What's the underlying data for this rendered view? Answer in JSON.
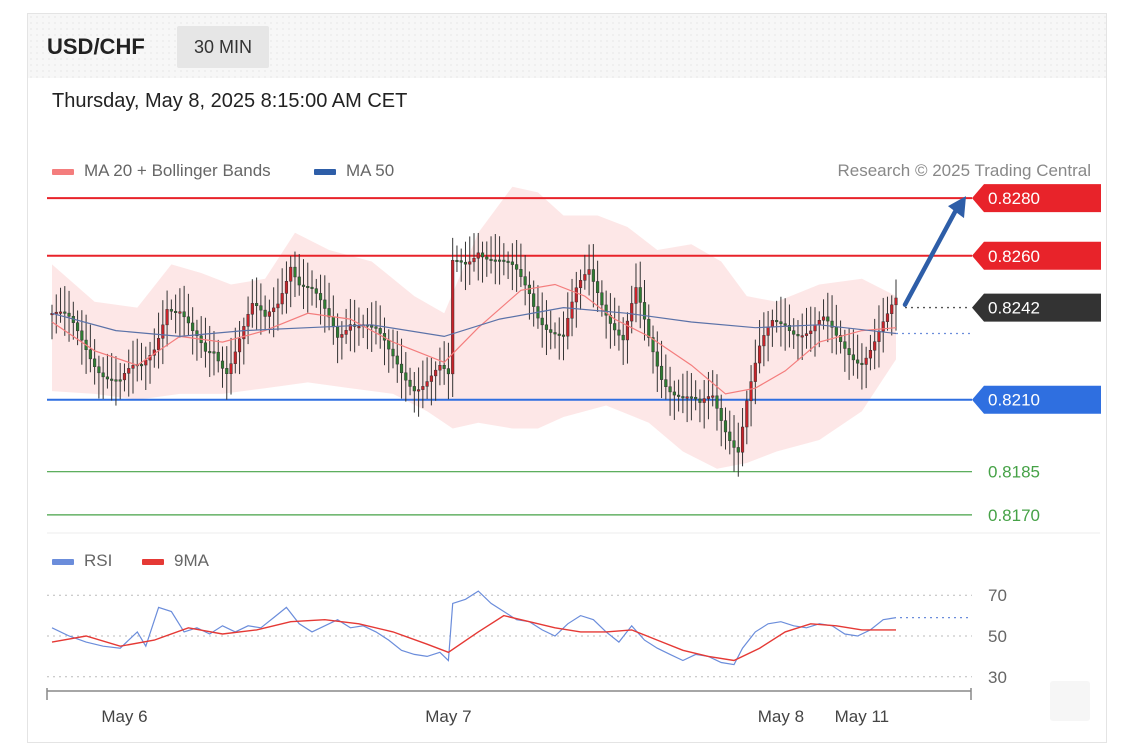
{
  "header": {
    "pair": "USD/CHF",
    "timeframe": "30 MIN",
    "datetime": "Thursday, May 8, 2025 8:15:00 AM CET"
  },
  "legend": {
    "ma20_label": "MA 20 + Bollinger Bands",
    "ma50_label": "MA 50",
    "copyright": "Research © 2025 Trading Central",
    "rsi_label": "RSI",
    "rsi_ma_label": "9MA"
  },
  "colors": {
    "resistance": "#e8232a",
    "support": "#2f6fe0",
    "target": "#46a247",
    "current": "#333333",
    "ma50": "#5b72a8",
    "ma20": "#f47d7d",
    "bollinger": "#fde3e3",
    "arrow": "#2e5ea8",
    "bull": "#c8232a",
    "bear": "#2e7d32",
    "rsi": "#6b8ddb",
    "rsi_ma": "#e53935"
  },
  "chart_data": [
    {
      "type": "candlestick",
      "title": "USD/CHF 30 MIN",
      "x_ticks": [
        "May 6",
        "May 7",
        "May 8",
        "May 11"
      ],
      "ylim": [
        0.8163,
        0.8295
      ],
      "levels": [
        {
          "value": 0.828,
          "label": "0.8280",
          "kind": "resistance"
        },
        {
          "value": 0.826,
          "label": "0.8260",
          "kind": "resistance"
        },
        {
          "value": 0.8242,
          "label": "0.8242",
          "kind": "current"
        },
        {
          "value": 0.821,
          "label": "0.8210",
          "kind": "support"
        },
        {
          "value": 0.8185,
          "label": "0.8185",
          "kind": "target"
        },
        {
          "value": 0.817,
          "label": "0.8170",
          "kind": "target"
        }
      ],
      "close_path": [
        [
          0,
          0.824
        ],
        [
          4,
          0.8235
        ],
        [
          7,
          0.823
        ],
        [
          10,
          0.8225
        ],
        [
          13,
          0.822
        ],
        [
          16,
          0.8215
        ],
        [
          19,
          0.8218
        ],
        [
          21,
          0.822
        ],
        [
          24,
          0.823
        ],
        [
          27,
          0.8245
        ],
        [
          30,
          0.824
        ],
        [
          33,
          0.823
        ],
        [
          36,
          0.8225
        ],
        [
          38,
          0.8228
        ],
        [
          41,
          0.8223
        ],
        [
          44,
          0.8232
        ],
        [
          47,
          0.824
        ],
        [
          50,
          0.8236
        ],
        [
          53,
          0.8245
        ],
        [
          56,
          0.826
        ],
        [
          58,
          0.8252
        ],
        [
          61,
          0.8246
        ],
        [
          64,
          0.8238
        ],
        [
          67,
          0.8232
        ],
        [
          70,
          0.824
        ],
        [
          73,
          0.8238
        ],
        [
          76,
          0.8232
        ],
        [
          79,
          0.8224
        ],
        [
          82,
          0.822
        ],
        [
          85,
          0.8217
        ],
        [
          88,
          0.8218
        ],
        [
          91,
          0.8219
        ],
        [
          93,
          0.8215
        ],
        [
          94,
          0.8255
        ],
        [
          97,
          0.8258
        ],
        [
          100,
          0.8265
        ],
        [
          103,
          0.826
        ],
        [
          106,
          0.8255
        ],
        [
          109,
          0.8252
        ],
        [
          112,
          0.8248
        ],
        [
          114,
          0.8242
        ],
        [
          117,
          0.8236
        ],
        [
          120,
          0.823
        ],
        [
          123,
          0.8245
        ],
        [
          126,
          0.8255
        ],
        [
          128,
          0.825
        ],
        [
          131,
          0.824
        ],
        [
          134,
          0.823
        ],
        [
          137,
          0.8245
        ],
        [
          140,
          0.823
        ],
        [
          143,
          0.822
        ],
        [
          146,
          0.8215
        ],
        [
          149,
          0.821
        ],
        [
          152,
          0.8205
        ],
        [
          155,
          0.821
        ],
        [
          158,
          0.8202
        ],
        [
          161,
          0.8195
        ],
        [
          163,
          0.821
        ],
        [
          166,
          0.8225
        ],
        [
          169,
          0.8235
        ],
        [
          172,
          0.8238
        ],
        [
          175,
          0.8236
        ],
        [
          178,
          0.8234
        ],
        [
          181,
          0.8235
        ],
        [
          184,
          0.823
        ],
        [
          187,
          0.8228
        ],
        [
          190,
          0.8226
        ],
        [
          193,
          0.823
        ],
        [
          196,
          0.8236
        ],
        [
          198,
          0.8242
        ]
      ],
      "ma20": [
        [
          0,
          0.8237
        ],
        [
          10,
          0.8227
        ],
        [
          20,
          0.8222
        ],
        [
          30,
          0.8232
        ],
        [
          40,
          0.823
        ],
        [
          50,
          0.8234
        ],
        [
          60,
          0.824
        ],
        [
          70,
          0.8238
        ],
        [
          80,
          0.823
        ],
        [
          92,
          0.8223
        ],
        [
          100,
          0.8235
        ],
        [
          110,
          0.8248
        ],
        [
          118,
          0.825
        ],
        [
          125,
          0.8246
        ],
        [
          132,
          0.8238
        ],
        [
          140,
          0.8232
        ],
        [
          150,
          0.8222
        ],
        [
          158,
          0.8212
        ],
        [
          165,
          0.8214
        ],
        [
          172,
          0.822
        ],
        [
          180,
          0.823
        ],
        [
          190,
          0.8234
        ],
        [
          198,
          0.8235
        ]
      ],
      "ma50": [
        [
          0,
          0.824
        ],
        [
          15,
          0.8234
        ],
        [
          30,
          0.8232
        ],
        [
          45,
          0.8234
        ],
        [
          60,
          0.8235
        ],
        [
          75,
          0.8236
        ],
        [
          92,
          0.8232
        ],
        [
          105,
          0.8238
        ],
        [
          120,
          0.8242
        ],
        [
          135,
          0.824
        ],
        [
          150,
          0.8237
        ],
        [
          165,
          0.8235
        ],
        [
          180,
          0.8236
        ],
        [
          198,
          0.8233
        ]
      ],
      "bb_upper": [
        [
          0,
          0.8257
        ],
        [
          10,
          0.8244
        ],
        [
          20,
          0.8242
        ],
        [
          28,
          0.8257
        ],
        [
          35,
          0.8254
        ],
        [
          42,
          0.825
        ],
        [
          50,
          0.8252
        ],
        [
          57,
          0.8268
        ],
        [
          65,
          0.8262
        ],
        [
          75,
          0.8258
        ],
        [
          85,
          0.8246
        ],
        [
          92,
          0.824
        ],
        [
          100,
          0.8268
        ],
        [
          108,
          0.8284
        ],
        [
          114,
          0.8282
        ],
        [
          120,
          0.8274
        ],
        [
          128,
          0.8274
        ],
        [
          135,
          0.827
        ],
        [
          142,
          0.8262
        ],
        [
          150,
          0.8264
        ],
        [
          157,
          0.8258
        ],
        [
          163,
          0.8246
        ],
        [
          170,
          0.8244
        ],
        [
          180,
          0.825
        ],
        [
          190,
          0.8252
        ],
        [
          198,
          0.8246
        ]
      ],
      "bb_lower": [
        [
          0,
          0.8213
        ],
        [
          10,
          0.8212
        ],
        [
          20,
          0.821
        ],
        [
          30,
          0.8212
        ],
        [
          40,
          0.8212
        ],
        [
          50,
          0.8214
        ],
        [
          60,
          0.8216
        ],
        [
          70,
          0.8214
        ],
        [
          80,
          0.8212
        ],
        [
          88,
          0.8206
        ],
        [
          94,
          0.82
        ],
        [
          100,
          0.8202
        ],
        [
          108,
          0.82
        ],
        [
          114,
          0.82
        ],
        [
          120,
          0.8204
        ],
        [
          130,
          0.8208
        ],
        [
          140,
          0.8202
        ],
        [
          148,
          0.8192
        ],
        [
          156,
          0.8186
        ],
        [
          163,
          0.8188
        ],
        [
          170,
          0.8192
        ],
        [
          180,
          0.8196
        ],
        [
          190,
          0.8206
        ],
        [
          198,
          0.8224
        ]
      ],
      "forecast_arrow": {
        "from": 0.8243,
        "to": 0.828
      }
    },
    {
      "type": "line",
      "title": "RSI",
      "ylim": [
        25,
        75
      ],
      "y_ticks": [
        70,
        50,
        30
      ],
      "series": [
        {
          "name": "RSI",
          "values": [
            [
              0,
              54
            ],
            [
              4,
              50
            ],
            [
              8,
              47
            ],
            [
              12,
              45
            ],
            [
              16,
              44
            ],
            [
              20,
              52
            ],
            [
              22,
              45
            ],
            [
              25,
              64
            ],
            [
              28,
              62
            ],
            [
              31,
              52
            ],
            [
              34,
              54
            ],
            [
              37,
              51
            ],
            [
              40,
              55
            ],
            [
              43,
              52
            ],
            [
              46,
              55
            ],
            [
              49,
              54
            ],
            [
              52,
              59
            ],
            [
              55,
              64
            ],
            [
              58,
              56
            ],
            [
              61,
              52
            ],
            [
              64,
              55
            ],
            [
              67,
              58
            ],
            [
              70,
              54
            ],
            [
              73,
              55
            ],
            [
              76,
              52
            ],
            [
              79,
              48
            ],
            [
              82,
              43
            ],
            [
              85,
              41
            ],
            [
              88,
              40
            ],
            [
              91,
              42
            ],
            [
              93,
              38
            ],
            [
              94,
              66
            ],
            [
              97,
              68
            ],
            [
              100,
              72
            ],
            [
              103,
              66
            ],
            [
              106,
              62
            ],
            [
              109,
              58
            ],
            [
              112,
              57
            ],
            [
              115,
              53
            ],
            [
              118,
              50
            ],
            [
              121,
              56
            ],
            [
              124,
              60
            ],
            [
              127,
              58
            ],
            [
              130,
              52
            ],
            [
              133,
              47
            ],
            [
              136,
              55
            ],
            [
              139,
              48
            ],
            [
              142,
              44
            ],
            [
              145,
              41
            ],
            [
              148,
              38
            ],
            [
              151,
              41
            ],
            [
              154,
              40
            ],
            [
              157,
              37
            ],
            [
              160,
              36
            ],
            [
              162,
              44
            ],
            [
              165,
              52
            ],
            [
              168,
              56
            ],
            [
              171,
              57
            ],
            [
              174,
              55
            ],
            [
              177,
              54
            ],
            [
              180,
              56
            ],
            [
              183,
              55
            ],
            [
              186,
              51
            ],
            [
              189,
              50
            ],
            [
              192,
              53
            ],
            [
              195,
              58
            ],
            [
              198,
              59
            ]
          ]
        },
        {
          "name": "9MA",
          "values": [
            [
              0,
              47
            ],
            [
              8,
              50
            ],
            [
              16,
              45
            ],
            [
              24,
              48
            ],
            [
              32,
              54
            ],
            [
              40,
              51
            ],
            [
              48,
              53
            ],
            [
              56,
              57
            ],
            [
              64,
              58
            ],
            [
              72,
              56
            ],
            [
              80,
              52
            ],
            [
              88,
              46
            ],
            [
              93,
              42
            ],
            [
              100,
              52
            ],
            [
              106,
              60
            ],
            [
              112,
              57
            ],
            [
              118,
              54
            ],
            [
              124,
              52
            ],
            [
              130,
              52
            ],
            [
              136,
              53
            ],
            [
              142,
              48
            ],
            [
              148,
              43
            ],
            [
              154,
              40
            ],
            [
              160,
              38
            ],
            [
              166,
              44
            ],
            [
              172,
              52
            ],
            [
              178,
              56
            ],
            [
              184,
              55
            ],
            [
              190,
              53
            ],
            [
              198,
              53
            ]
          ]
        }
      ]
    }
  ]
}
